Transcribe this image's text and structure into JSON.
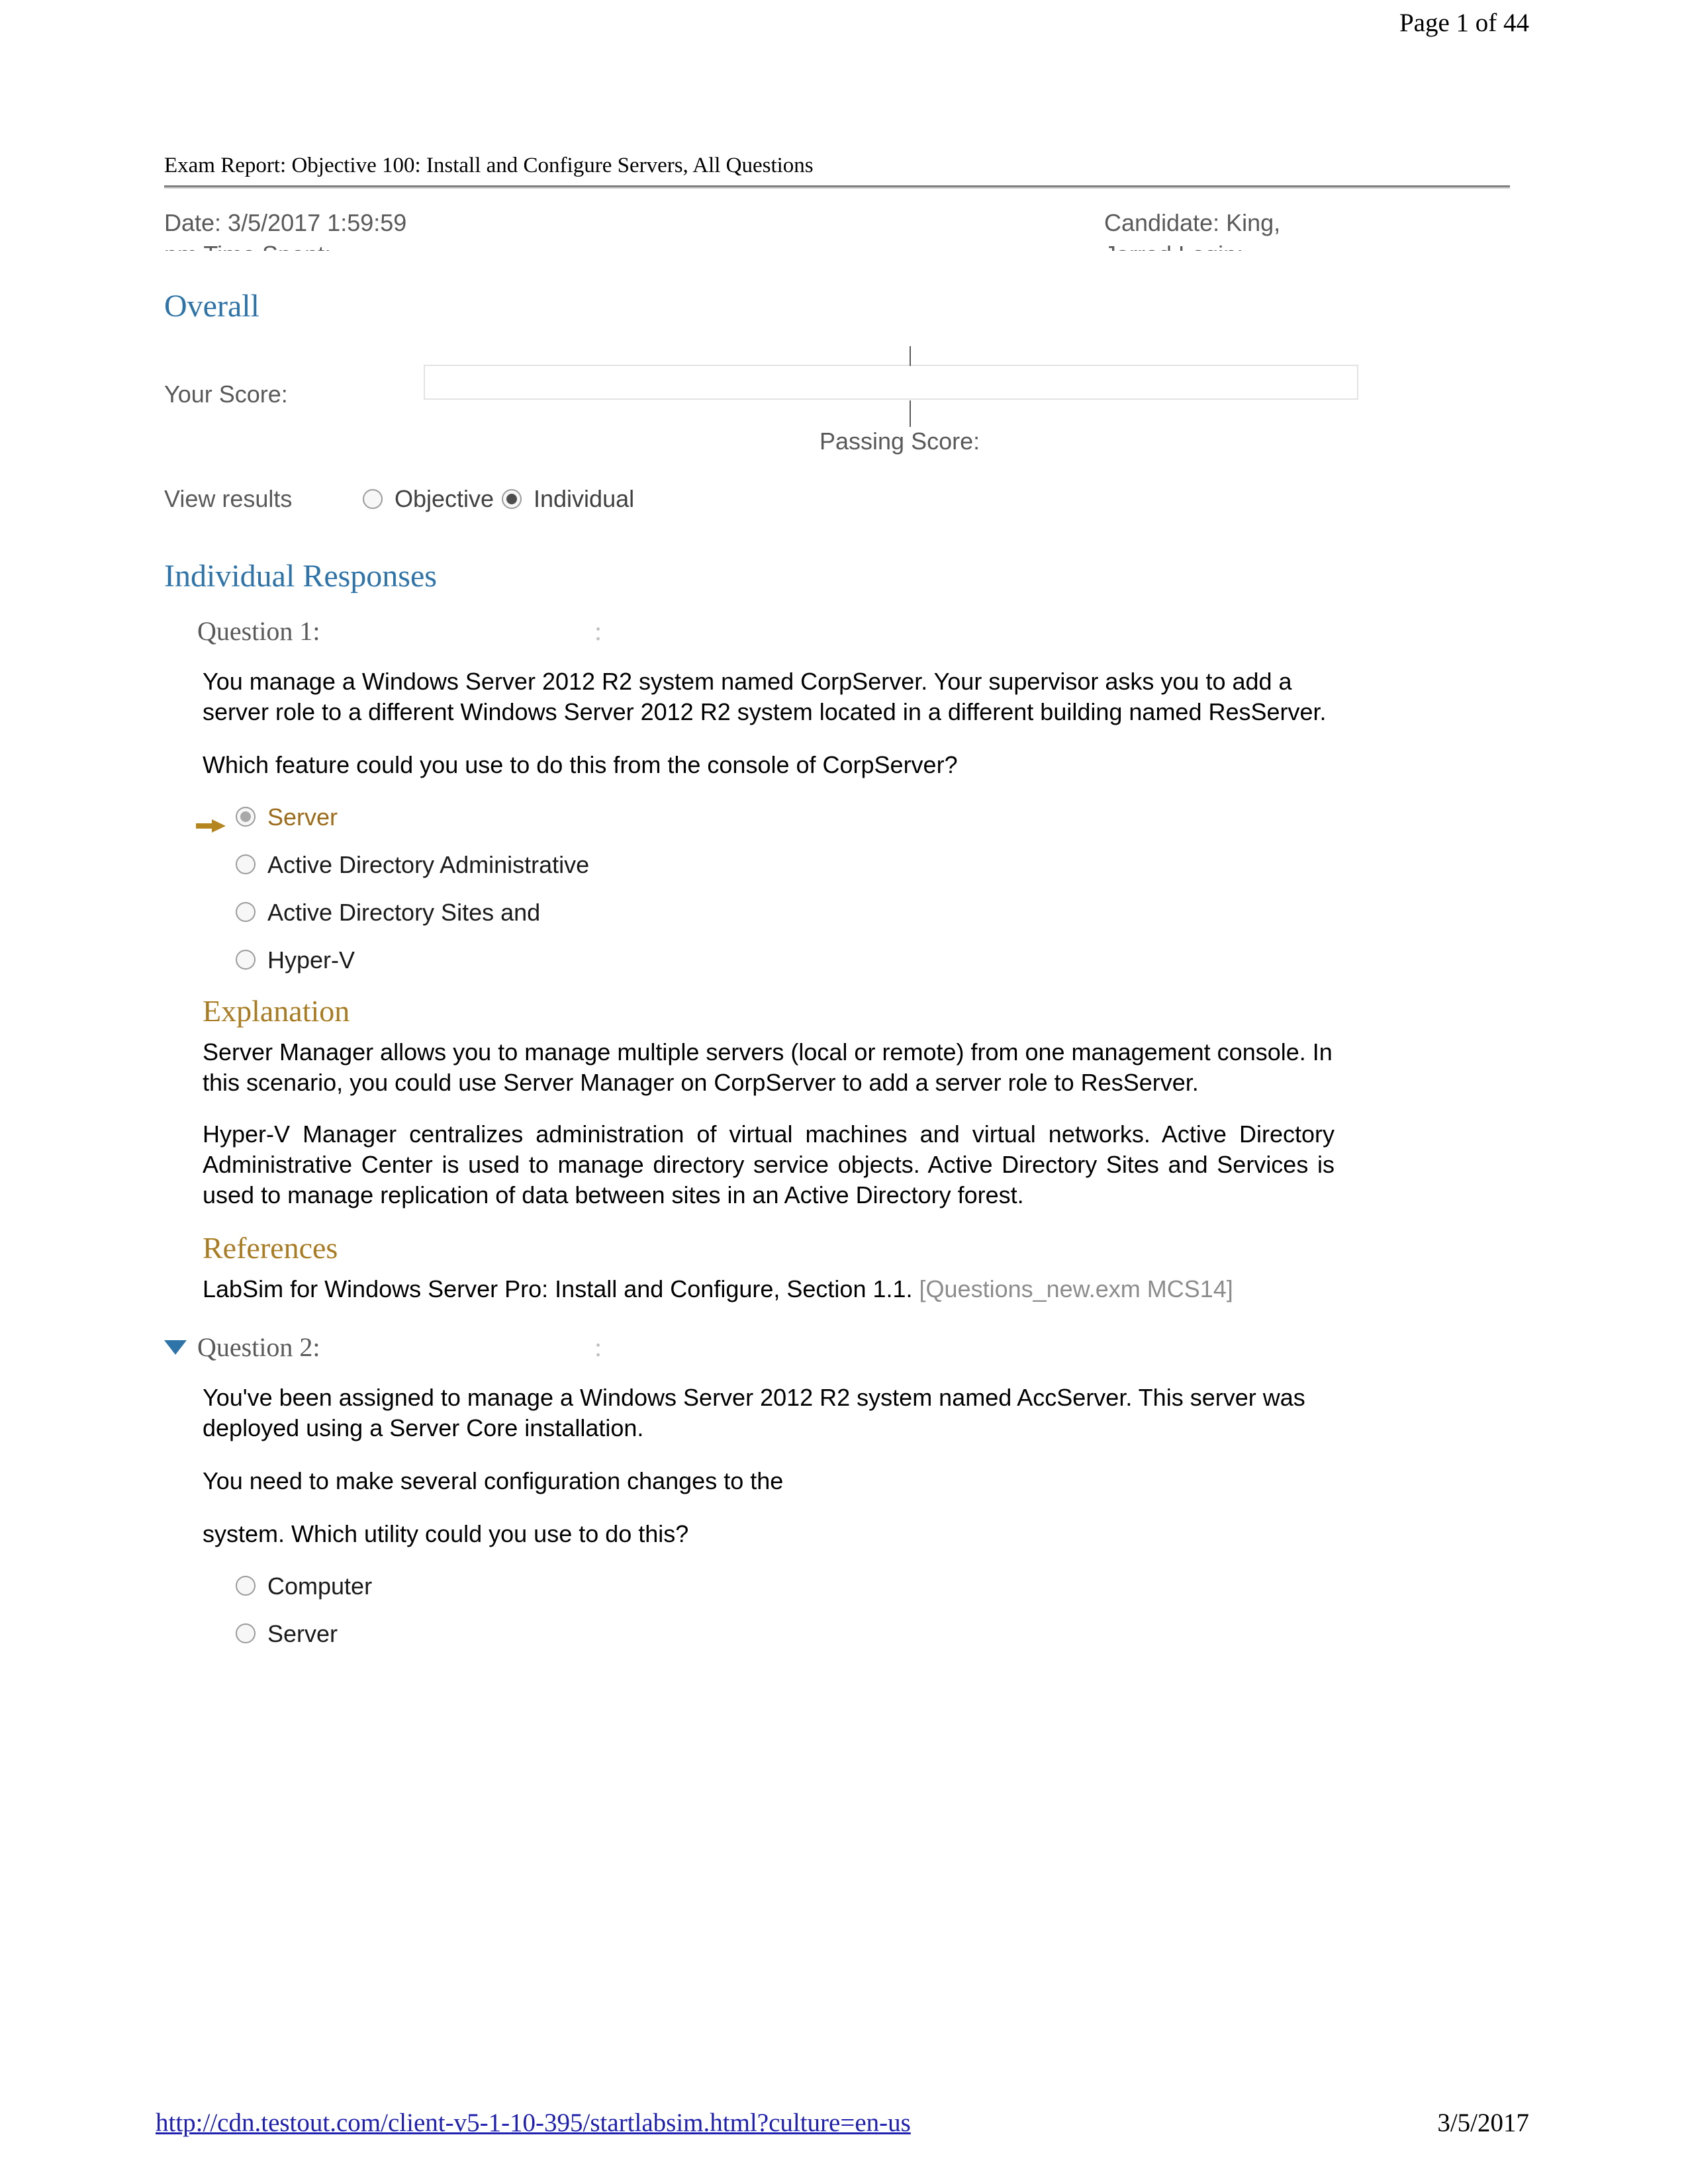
{
  "page_header": {
    "page_indicator": "Page 1 of 44"
  },
  "page_footer": {
    "url": "http://cdn.testout.com/client-v5-1-10-395/startlabsim.html?culture=en-us",
    "date": "3/5/2017"
  },
  "report": {
    "title": "Exam Report: Objective 100: Install and Configure Servers, All Questions",
    "meta": {
      "left_line1": "Date: 3/5/2017 1:59:59",
      "left_line2": "pm Time Spent:",
      "right_line1": "Candidate: King,",
      "right_line2": "Jarred Login:"
    },
    "overall": {
      "heading": "Overall",
      "your_score_label": "Your Score:",
      "passing_score_label": "Passing Score:",
      "your_score_percent": 0,
      "passing_score_percent": 52
    },
    "view_results": {
      "label": "View results",
      "options": [
        {
          "label": "Objective",
          "selected": false
        },
        {
          "label": "Individual",
          "selected": true
        }
      ]
    },
    "individual_responses": {
      "heading": "Individual Responses",
      "questions": [
        {
          "header": "Question 1:",
          "header_trailing_mark": ":",
          "collapse_icon": "none",
          "paragraphs": [
            "You manage a Windows Server 2012 R2 system named CorpServer. Your supervisor asks you to add a server role to a different Windows Server 2012 R2 system located in a different building named ResServer.",
            "Which feature could you use to do this from the console of CorpServer?"
          ],
          "answers": [
            {
              "label": "Server",
              "selected": true,
              "correct_marker": true
            },
            {
              "label": "Active Directory Administrative",
              "selected": false,
              "correct_marker": false
            },
            {
              "label": "Active Directory Sites and",
              "selected": false,
              "correct_marker": false
            },
            {
              "label": "Hyper-V",
              "selected": false,
              "correct_marker": false
            }
          ],
          "explanation": {
            "heading": "Explanation",
            "paragraphs": [
              "Server Manager allows you to manage multiple servers (local or remote) from one management console. In this scenario, you could use Server Manager on CorpServer to add a server role to ResServer.",
              "Hyper-V Manager centralizes administration of virtual machines and virtual networks. Active Directory Administrative Center is used to manage directory service objects. Active Directory Sites and Services is used to manage replication of data between sites in an Active Directory forest."
            ]
          },
          "references": {
            "heading": "References",
            "text": "LabSim for Windows Server Pro: Install and Configure, Section 1.1.",
            "tag": "[Questions_new.exm MCS14]"
          }
        },
        {
          "header": "Question 2:",
          "header_trailing_mark": ":",
          "collapse_icon": "triangle-down-icon",
          "paragraphs": [
            "You've been assigned to manage a Windows Server 2012 R2 system named AccServer. This server was deployed using a Server Core installation.",
            "You need to make several configuration changes to the",
            "system. Which utility could you use to do this?"
          ],
          "answers": [
            {
              "label": "Computer",
              "selected": false,
              "correct_marker": false
            },
            {
              "label": "Server",
              "selected": false,
              "correct_marker": false
            }
          ]
        }
      ]
    }
  },
  "colors": {
    "section_heading": "#2e74a8",
    "sub_heading": "#a97c23",
    "correct_answer": "#9c6b1a",
    "arrow": "#b5861f",
    "meta_text": "#595959",
    "link": "#2020b0",
    "ref_tag": "#8c8c8c"
  }
}
